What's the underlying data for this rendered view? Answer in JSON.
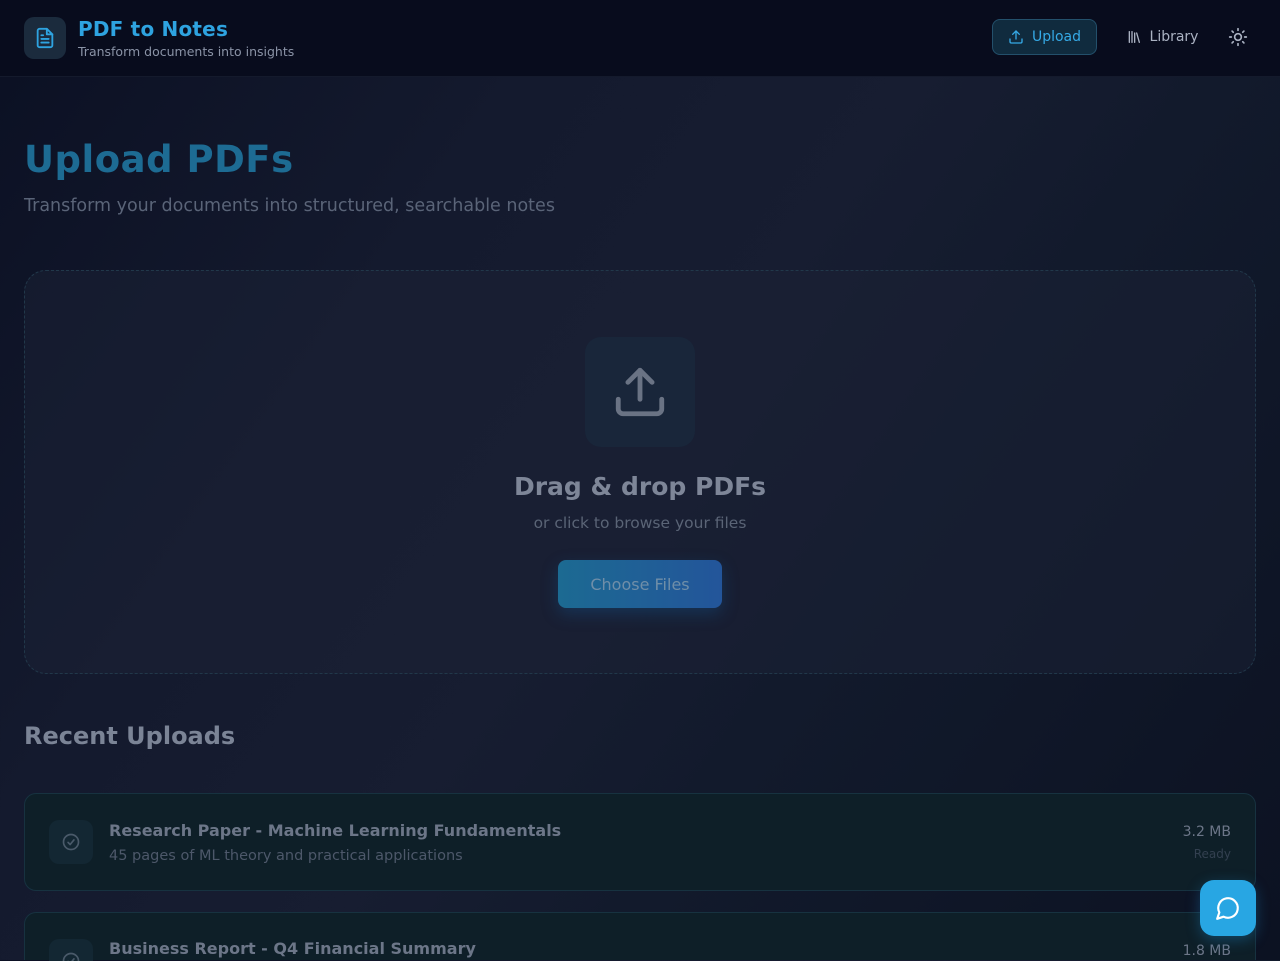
{
  "header": {
    "title": "PDF to Notes",
    "subtitle": "Transform documents into insights",
    "nav": {
      "upload_label": "Upload",
      "library_label": "Library"
    },
    "theme_icon": "sun-icon",
    "colors": {
      "accent": "#2ea3e0",
      "active_nav_bg": "#102b3e"
    }
  },
  "main": {
    "title": "Upload PDFs",
    "subtitle": "Transform your documents into structured, searchable notes",
    "dropzone": {
      "icon": "upload-icon",
      "title": "Drag & drop PDFs",
      "subtitle": "or click to browse your files",
      "button_label": "Choose Files"
    },
    "recent": {
      "title": "Recent Uploads",
      "items": [
        {
          "title": "Research Paper - Machine Learning Fundamentals",
          "description": "45 pages of ML theory and practical applications",
          "size": "3.2 MB",
          "status": "Ready",
          "icon": "check-circle-icon"
        },
        {
          "title": "Business Report - Q4 Financial Summary",
          "description": "",
          "size": "1.8 MB",
          "status": "",
          "icon": "check-circle-icon"
        }
      ]
    }
  },
  "chat": {
    "icon": "chat-bubble-icon",
    "color": "#28a6e3"
  }
}
